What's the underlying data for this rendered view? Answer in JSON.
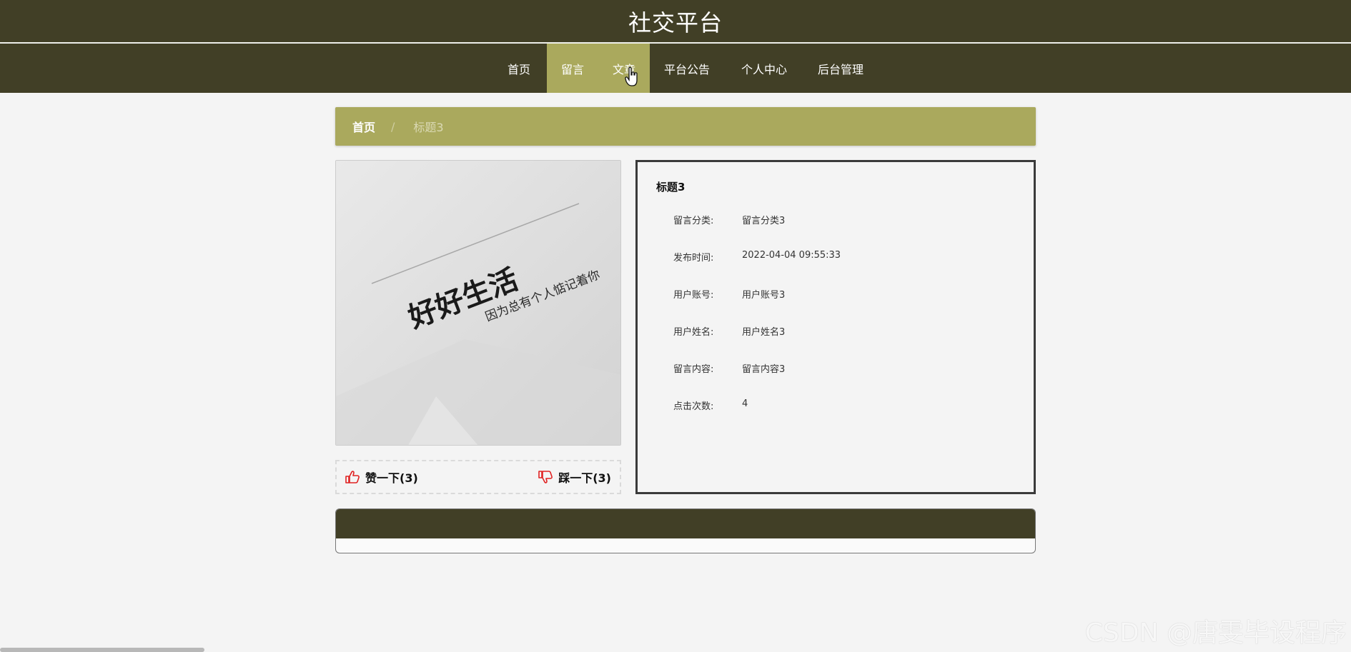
{
  "site": {
    "title": "社交平台"
  },
  "nav": {
    "items": [
      {
        "label": "首页"
      },
      {
        "label": "留言"
      },
      {
        "label": "文章"
      },
      {
        "label": "平台公告"
      },
      {
        "label": "个人中心"
      },
      {
        "label": "后台管理"
      }
    ],
    "active": "留言"
  },
  "breadcrumb": {
    "home": "首页",
    "separator": "/",
    "current": "标题3"
  },
  "image": {
    "headline": "好好生活",
    "subline": "因为总有个人惦记着你"
  },
  "votes": {
    "like_label": "赞一下(3)",
    "dislike_label": "踩一下(3)"
  },
  "detail": {
    "title": "标题3",
    "fields": [
      {
        "label": "留言分类:",
        "value": "留言分类3"
      },
      {
        "label": "发布时间:",
        "value": "2022-04-04 09:55:33"
      },
      {
        "label": "用户账号:",
        "value": "用户账号3"
      },
      {
        "label": "用户姓名:",
        "value": "用户姓名3"
      },
      {
        "label": "留言内容:",
        "value": "留言内容3"
      },
      {
        "label": "点击次数:",
        "value": "4"
      }
    ]
  },
  "watermark": "CSDN @唐雯毕设程序",
  "colors": {
    "header_bg": "#413f26",
    "accent": "#aaa95d",
    "icon_red": "#e02222"
  }
}
